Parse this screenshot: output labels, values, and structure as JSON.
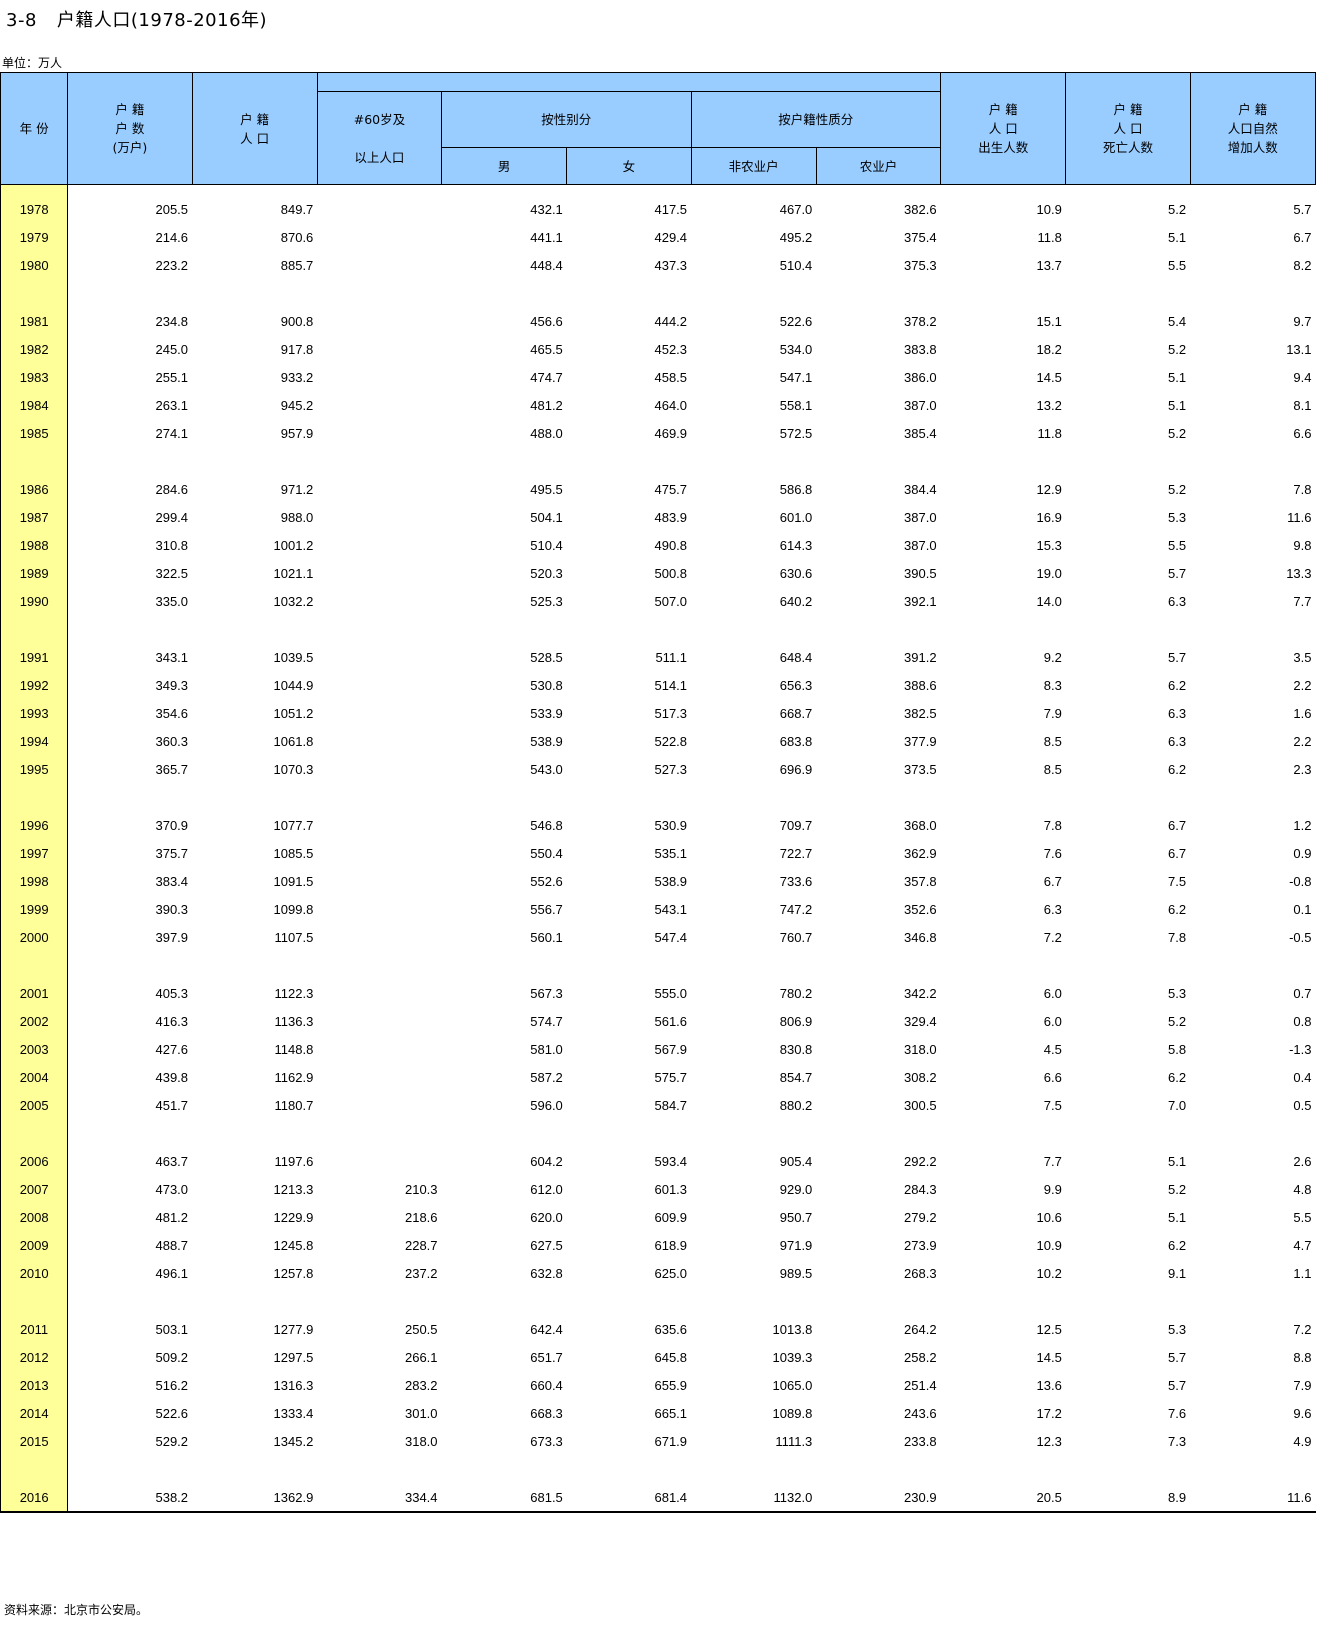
{
  "header": {
    "table_number": "3-8",
    "title": "户籍人口(1978-2016年)",
    "unit": "单位：万人"
  },
  "columns": {
    "year": "年  份",
    "households": "户 籍\n户 数\n(万户)",
    "population": "户 籍\n人 口",
    "aged60": "#60岁及\n\n以上人口",
    "by_sex": "按性别分",
    "male": "男",
    "female": "女",
    "by_hukou": "按户籍性质分",
    "non_agri": "非农业户",
    "agri": "农业户",
    "births": "户   籍\n人   口\n出生人数",
    "deaths": "户   籍\n人   口\n死亡人数",
    "natural_increase": "户   籍\n人口自然\n增加人数"
  },
  "rows": [
    [
      "1978",
      "205.5",
      "849.7",
      "",
      "432.1",
      "417.5",
      "467.0",
      "382.6",
      "10.9",
      "5.2",
      "5.7"
    ],
    [
      "1979",
      "214.6",
      "870.6",
      "",
      "441.1",
      "429.4",
      "495.2",
      "375.4",
      "11.8",
      "5.1",
      "6.7"
    ],
    [
      "1980",
      "223.2",
      "885.7",
      "",
      "448.4",
      "437.3",
      "510.4",
      "375.3",
      "13.7",
      "5.5",
      "8.2"
    ],
    null,
    [
      "1981",
      "234.8",
      "900.8",
      "",
      "456.6",
      "444.2",
      "522.6",
      "378.2",
      "15.1",
      "5.4",
      "9.7"
    ],
    [
      "1982",
      "245.0",
      "917.8",
      "",
      "465.5",
      "452.3",
      "534.0",
      "383.8",
      "18.2",
      "5.2",
      "13.1"
    ],
    [
      "1983",
      "255.1",
      "933.2",
      "",
      "474.7",
      "458.5",
      "547.1",
      "386.0",
      "14.5",
      "5.1",
      "9.4"
    ],
    [
      "1984",
      "263.1",
      "945.2",
      "",
      "481.2",
      "464.0",
      "558.1",
      "387.0",
      "13.2",
      "5.1",
      "8.1"
    ],
    [
      "1985",
      "274.1",
      "957.9",
      "",
      "488.0",
      "469.9",
      "572.5",
      "385.4",
      "11.8",
      "5.2",
      "6.6"
    ],
    null,
    [
      "1986",
      "284.6",
      "971.2",
      "",
      "495.5",
      "475.7",
      "586.8",
      "384.4",
      "12.9",
      "5.2",
      "7.8"
    ],
    [
      "1987",
      "299.4",
      "988.0",
      "",
      "504.1",
      "483.9",
      "601.0",
      "387.0",
      "16.9",
      "5.3",
      "11.6"
    ],
    [
      "1988",
      "310.8",
      "1001.2",
      "",
      "510.4",
      "490.8",
      "614.3",
      "387.0",
      "15.3",
      "5.5",
      "9.8"
    ],
    [
      "1989",
      "322.5",
      "1021.1",
      "",
      "520.3",
      "500.8",
      "630.6",
      "390.5",
      "19.0",
      "5.7",
      "13.3"
    ],
    [
      "1990",
      "335.0",
      "1032.2",
      "",
      "525.3",
      "507.0",
      "640.2",
      "392.1",
      "14.0",
      "6.3",
      "7.7"
    ],
    null,
    [
      "1991",
      "343.1",
      "1039.5",
      "",
      "528.5",
      "511.1",
      "648.4",
      "391.2",
      "9.2",
      "5.7",
      "3.5"
    ],
    [
      "1992",
      "349.3",
      "1044.9",
      "",
      "530.8",
      "514.1",
      "656.3",
      "388.6",
      "8.3",
      "6.2",
      "2.2"
    ],
    [
      "1993",
      "354.6",
      "1051.2",
      "",
      "533.9",
      "517.3",
      "668.7",
      "382.5",
      "7.9",
      "6.3",
      "1.6"
    ],
    [
      "1994",
      "360.3",
      "1061.8",
      "",
      "538.9",
      "522.8",
      "683.8",
      "377.9",
      "8.5",
      "6.3",
      "2.2"
    ],
    [
      "1995",
      "365.7",
      "1070.3",
      "",
      "543.0",
      "527.3",
      "696.9",
      "373.5",
      "8.5",
      "6.2",
      "2.3"
    ],
    null,
    [
      "1996",
      "370.9",
      "1077.7",
      "",
      "546.8",
      "530.9",
      "709.7",
      "368.0",
      "7.8",
      "6.7",
      "1.2"
    ],
    [
      "1997",
      "375.7",
      "1085.5",
      "",
      "550.4",
      "535.1",
      "722.7",
      "362.9",
      "7.6",
      "6.7",
      "0.9"
    ],
    [
      "1998",
      "383.4",
      "1091.5",
      "",
      "552.6",
      "538.9",
      "733.6",
      "357.8",
      "6.7",
      "7.5",
      "-0.8"
    ],
    [
      "1999",
      "390.3",
      "1099.8",
      "",
      "556.7",
      "543.1",
      "747.2",
      "352.6",
      "6.3",
      "6.2",
      "0.1"
    ],
    [
      "2000",
      "397.9",
      "1107.5",
      "",
      "560.1",
      "547.4",
      "760.7",
      "346.8",
      "7.2",
      "7.8",
      "-0.5"
    ],
    null,
    [
      "2001",
      "405.3",
      "1122.3",
      "",
      "567.3",
      "555.0",
      "780.2",
      "342.2",
      "6.0",
      "5.3",
      "0.7"
    ],
    [
      "2002",
      "416.3",
      "1136.3",
      "",
      "574.7",
      "561.6",
      "806.9",
      "329.4",
      "6.0",
      "5.2",
      "0.8"
    ],
    [
      "2003",
      "427.6",
      "1148.8",
      "",
      "581.0",
      "567.9",
      "830.8",
      "318.0",
      "4.5",
      "5.8",
      "-1.3"
    ],
    [
      "2004",
      "439.8",
      "1162.9",
      "",
      "587.2",
      "575.7",
      "854.7",
      "308.2",
      "6.6",
      "6.2",
      "0.4"
    ],
    [
      "2005",
      "451.7",
      "1180.7",
      "",
      "596.0",
      "584.7",
      "880.2",
      "300.5",
      "7.5",
      "7.0",
      "0.5"
    ],
    null,
    [
      "2006",
      "463.7",
      "1197.6",
      "",
      "604.2",
      "593.4",
      "905.4",
      "292.2",
      "7.7",
      "5.1",
      "2.6"
    ],
    [
      "2007",
      "473.0",
      "1213.3",
      "210.3",
      "612.0",
      "601.3",
      "929.0",
      "284.3",
      "9.9",
      "5.2",
      "4.8"
    ],
    [
      "2008",
      "481.2",
      "1229.9",
      "218.6",
      "620.0",
      "609.9",
      "950.7",
      "279.2",
      "10.6",
      "5.1",
      "5.5"
    ],
    [
      "2009",
      "488.7",
      "1245.8",
      "228.7",
      "627.5",
      "618.9",
      "971.9",
      "273.9",
      "10.9",
      "6.2",
      "4.7"
    ],
    [
      "2010",
      "496.1",
      "1257.8",
      "237.2",
      "632.8",
      "625.0",
      "989.5",
      "268.3",
      "10.2",
      "9.1",
      "1.1"
    ],
    null,
    [
      "2011",
      "503.1",
      "1277.9",
      "250.5",
      "642.4",
      "635.6",
      "1013.8",
      "264.2",
      "12.5",
      "5.3",
      "7.2"
    ],
    [
      "2012",
      "509.2",
      "1297.5",
      "266.1",
      "651.7",
      "645.8",
      "1039.3",
      "258.2",
      "14.5",
      "5.7",
      "8.8"
    ],
    [
      "2013",
      "516.2",
      "1316.3",
      "283.2",
      "660.4",
      "655.9",
      "1065.0",
      "251.4",
      "13.6",
      "5.7",
      "7.9"
    ],
    [
      "2014",
      "522.6",
      "1333.4",
      "301.0",
      "668.3",
      "665.1",
      "1089.8",
      "243.6",
      "17.2",
      "7.6",
      "9.6"
    ],
    [
      "2015",
      "529.2",
      "1345.2",
      "318.0",
      "673.3",
      "671.9",
      "1111.3",
      "233.8",
      "12.3",
      "7.3",
      "4.9"
    ],
    null,
    [
      "2016",
      "538.2",
      "1362.9",
      "334.4",
      "681.5",
      "681.4",
      "1132.0",
      "230.9",
      "20.5",
      "8.9",
      "11.6"
    ]
  ],
  "footer": {
    "source": "资料来源：北京市公安局。"
  }
}
